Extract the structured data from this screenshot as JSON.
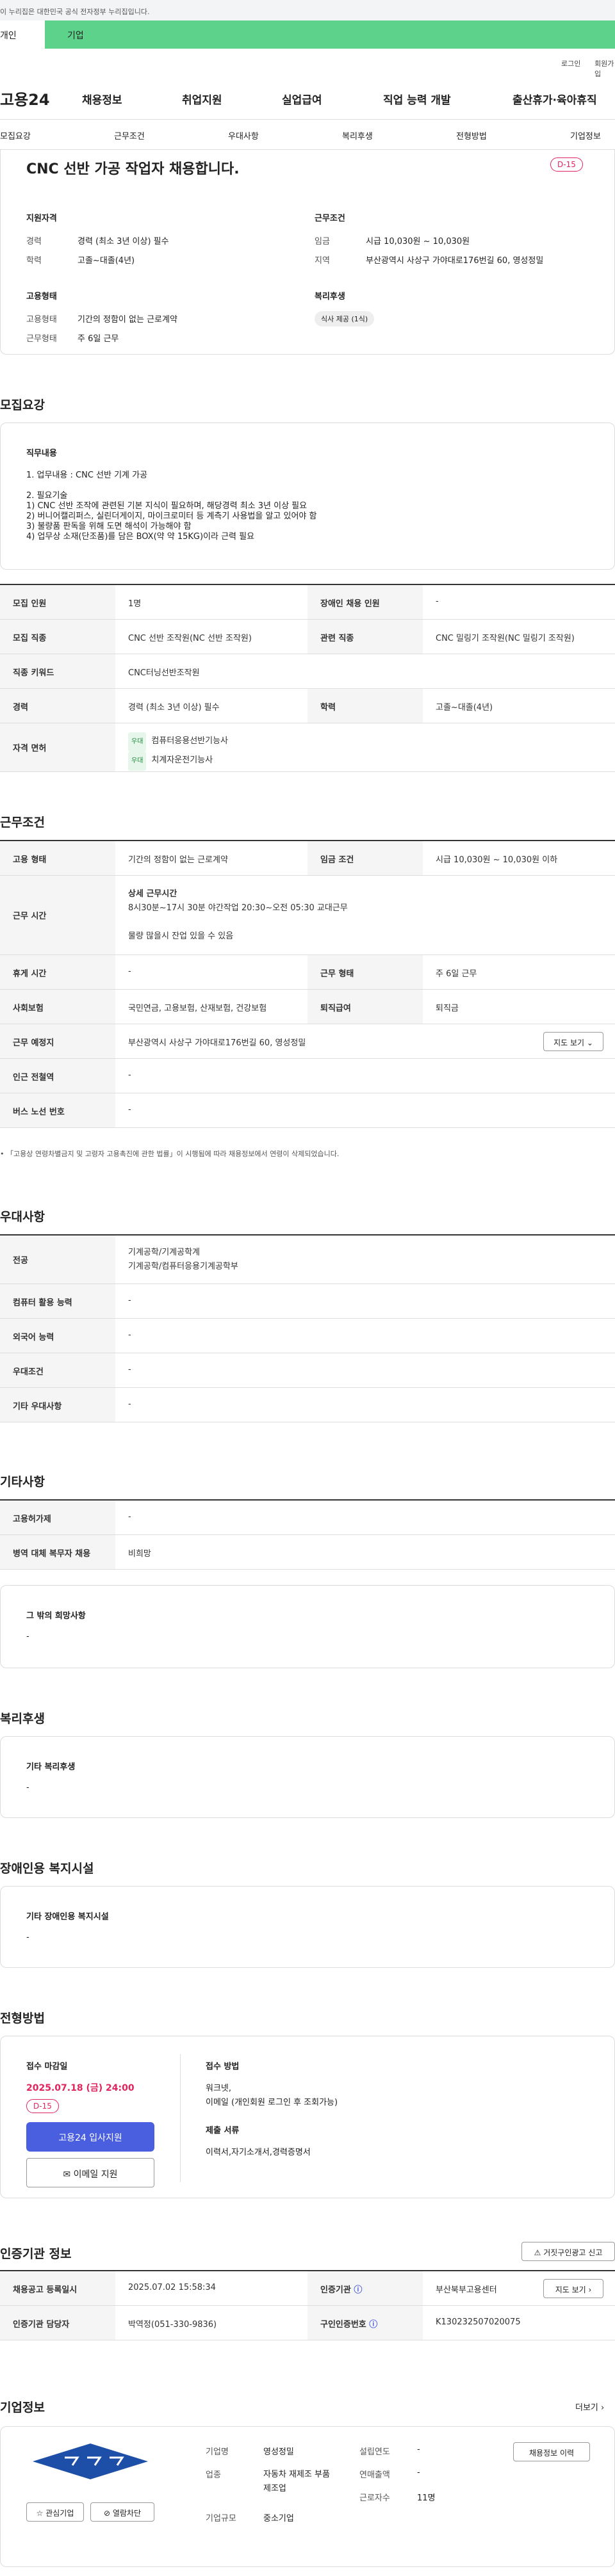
{
  "gov_notice": "이 누리집은 대한민국 공식 전자정부 누리집입니다.",
  "tabs": {
    "person": "개인",
    "corp": "기업"
  },
  "util": {
    "login": "로그인",
    "join": "회원가입"
  },
  "gnb": {
    "logo": "고용24",
    "menus": [
      "채용정보",
      "취업지원",
      "실업급여",
      "직업 능력 개발",
      "출산휴가·육아휴직"
    ]
  },
  "subnav": [
    "모집요강",
    "근무조건",
    "우대사항",
    "복리후생",
    "전형방법",
    "기업정보"
  ],
  "summary": {
    "title": "CNC 선반 가공 작업자 채용합니다.",
    "dday": "D-15",
    "qual_title": "지원자격",
    "career_l": "경력",
    "career_v": "경력 (최소 3년 이상) 필수",
    "edu_l": "학력",
    "edu_v": "고졸~대졸(4년)",
    "cond_title": "근무조건",
    "wage_l": "임금",
    "wage_v": "시급 10,030원 ~ 10,030원",
    "area_l": "지역",
    "area_v": "부산광역시 사상구 가야대로176번길 60, 영성정밀",
    "emp_title": "고용형태",
    "type_l": "고용형태",
    "type_v": "기간의 정함이 없는 근로계약",
    "form_l": "근무형태",
    "form_v": "주 6일 근무",
    "welfare_title": "복리후생",
    "welfare_pill": "식사 제공 (1식)"
  },
  "recruit": {
    "heading": "모집요강",
    "job_title": "직무내용",
    "lines": [
      "1. 업무내용 : CNC 선반 기계 가공",
      "",
      "2. 필요기술",
      "1) CNC 선반 조작에 관련된 기본 지식이 필요하며, 해당경력 최소 3년 이상 필요",
      "2) 버니어캘리퍼스, 실린더게이지, 마이크로미터 등 계측기 사용법을 알고 있어야 함",
      "3) 불량품 판독을 위해 도면 해석이 가능해야 함",
      "4) 업무상 소재(단조품)를 담은 BOX(약 약 15KG)이라 근력 필요"
    ],
    "t": {
      "h1": "모집 인원",
      "v1": "1명",
      "h2": "장애인 채용 인원",
      "v2": "-",
      "h3": "모집 직종",
      "v3": "CNC 선반 조작원(NC 선반 조작원)",
      "h4": "관련 직종",
      "v4": "CNC 밀링기 조작원(NC 밀링기 조작원)",
      "h5": "직종 키워드",
      "v5": "CNC터닝선반조작원",
      "h6": "경력",
      "v6": "경력 (최소 3년 이상) 필수",
      "h7": "학력",
      "v7": "고졸~대졸(4년)",
      "h8": "자격 면허",
      "badge": "우대",
      "lic1": "컴퓨터응용선반기능사",
      "lic2": "치계자운전기능사"
    }
  },
  "work": {
    "heading": "근무조건",
    "h1": "고용 형태",
    "v1": "기간의 정함이 없는 근로계약",
    "h2": "임금 조건",
    "v2": "시급 10,030원 ~ 10,030원 이하",
    "h3": "근무 시간",
    "v3a": "상세 근무시간",
    "v3b": "8시30분~17시 30분 야간작업 20:30~오전 05:30 교대근무",
    "v3c": "물량 많을시 잔업 있을 수 있음",
    "h4": "휴게 시간",
    "v4": "-",
    "h5": "근무 형태",
    "v5": "주 6일 근무",
    "h6": "사회보험",
    "v6": "국민연금, 고용보험, 산재보험, 건강보험",
    "h7": "퇴직급여",
    "v7": "퇴직금",
    "h8": "근무 예정지",
    "v8": "부산광역시 사상구 가야대로176번길 60, 영성정밀",
    "map": "지도 보기",
    "h9": "인근 전철역",
    "v9": "-",
    "h10": "버스 노선 번호",
    "v10": "-",
    "note": "「고용상 연령차별금지 및 고령자 고용촉진에 관한 법률」이 시행됨에 따라 채용정보에서 연령이 삭제되었습니다."
  },
  "pref": {
    "heading": "우대사항",
    "h1": "전공",
    "v1a": "기계공학/기계공학계",
    "v1b": "기계공학/컴퓨터응용기계공학부",
    "h2": "컴퓨터 활용 능력",
    "v2": "-",
    "h3": "외국어 능력",
    "v3": "-",
    "h4": "우대조건",
    "v4": "-",
    "h5": "기타 우대사항",
    "v5": "-"
  },
  "etc": {
    "heading": "기타사항",
    "h1": "고용허가제",
    "v1": "-",
    "h2": "병역 대체 복무자 채용",
    "v2": "비희망",
    "box_title": "그 밖의 희망사항",
    "box_v": "-"
  },
  "welfare": {
    "heading": "복리후생",
    "box_title": "기타 복리후생",
    "box_v": "-"
  },
  "disab": {
    "heading": "장애인용 복지시설",
    "box_title": "기타 장애인용 복지시설",
    "box_v": "-"
  },
  "process": {
    "heading": "전형방법",
    "deadline_l": "접수 마감일",
    "deadline_v": "2025.07.18 (금) 24:00",
    "dday": "D-15",
    "apply": "고용24 입사지원",
    "email": "이메일 지원",
    "method_l": "접수 방법",
    "method_v1": "워크넷,",
    "method_v2": "이메일 (개인회원 로그인 후 조회가능)",
    "docs_l": "제출 서류",
    "docs_v": "이력서,자기소개서,경력증명서"
  },
  "agency": {
    "heading": "인증기관 정보",
    "report": "거짓구인광고 신고",
    "h1": "채용공고 등록일시",
    "v1": "2025.07.02 15:58:34",
    "h2": "인증기관",
    "v2": "부산북부고용센터",
    "map": "지도 보기",
    "h3": "인증기관 담당자",
    "v3": "박역정(051-330-9836)",
    "h4": "구인인증번호",
    "v4": "K130232507020075"
  },
  "company": {
    "heading": "기업정보",
    "more": "더보기",
    "fav": "관심기업",
    "block": "열람차단",
    "history": "채용정보 이력",
    "l1": "기업명",
    "v1": "영성정밀",
    "l2": "업종",
    "v2": "자동차 재제조 부품 제조업",
    "l3": "기업규모",
    "v3": "중소기업",
    "l4": "설립연도",
    "v4": "-",
    "l5": "연매출액",
    "v5": "-",
    "l6": "근로자수",
    "v6": "11명"
  }
}
